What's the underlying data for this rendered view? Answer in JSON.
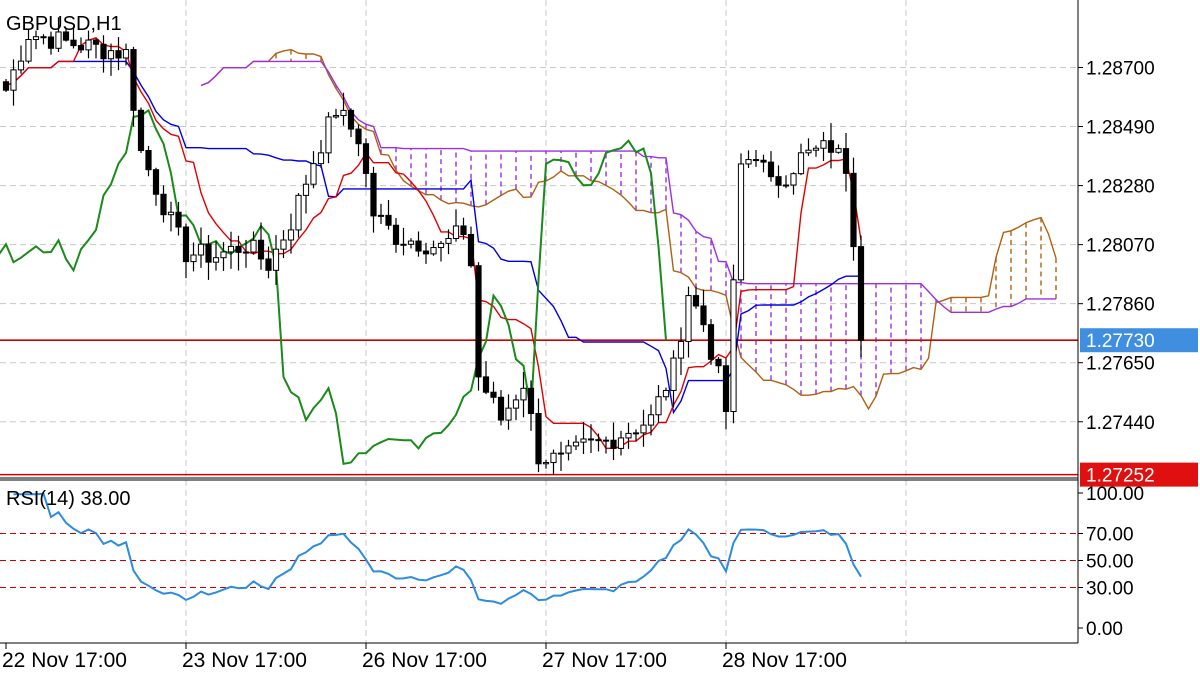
{
  "chart_data": [
    {
      "type": "candlestick",
      "symbol_label": "GBPUSD,H1",
      "y_ticks": [
        "1.28700",
        "1.28490",
        "1.28280",
        "1.28070",
        "1.27860",
        "1.27650",
        "1.27440"
      ],
      "ylim": [
        1.2724,
        1.2894
      ],
      "current_price_label": "1.27730",
      "current_price": 1.2773,
      "low_line_label": "1.27252",
      "low_line_price": 1.27252,
      "x_ticks": [
        "22 Nov 17:00",
        "23 Nov 17:00",
        "26 Nov 17:00",
        "27 Nov 17:00",
        "28 Nov 17:00"
      ],
      "x_tick_bars": [
        0,
        24,
        48,
        72,
        96
      ],
      "bar_count": 115,
      "cloud_forward_bars": 26,
      "anchors": [
        [
          0,
          1.2862
        ],
        [
          3,
          1.2882
        ],
        [
          8,
          1.2879
        ],
        [
          12,
          1.2877
        ],
        [
          16,
          1.2875
        ],
        [
          18,
          1.284
        ],
        [
          22,
          1.2815
        ],
        [
          24,
          1.2804
        ],
        [
          28,
          1.2803
        ],
        [
          32,
          1.2807
        ],
        [
          35,
          1.28
        ],
        [
          38,
          1.2815
        ],
        [
          41,
          1.2837
        ],
        [
          44,
          1.2855
        ],
        [
          47,
          1.2845
        ],
        [
          49,
          1.2818
        ],
        [
          52,
          1.281
        ],
        [
          55,
          1.2808
        ],
        [
          58,
          1.2806
        ],
        [
          61,
          1.2812
        ],
        [
          62,
          1.28
        ],
        [
          63,
          1.276
        ],
        [
          66,
          1.2745
        ],
        [
          69,
          1.2758
        ],
        [
          71,
          1.2732
        ],
        [
          74,
          1.273
        ],
        [
          77,
          1.2735
        ],
        [
          80,
          1.2737
        ],
        [
          83,
          1.2741
        ],
        [
          86,
          1.2745
        ],
        [
          89,
          1.2763
        ],
        [
          91,
          1.279
        ],
        [
          93,
          1.2779
        ],
        [
          95,
          1.276
        ],
        [
          96,
          1.2748
        ],
        [
          98,
          1.2835
        ],
        [
          100,
          1.284
        ],
        [
          102,
          1.2828
        ],
        [
          104,
          1.2832
        ],
        [
          106,
          1.2838
        ],
        [
          108,
          1.284
        ],
        [
          110,
          1.2842
        ],
        [
          112,
          1.2835
        ],
        [
          113,
          1.281
        ],
        [
          114,
          1.2773
        ]
      ],
      "tenkan_color": "#e00000",
      "kijun_color": "#0000e0",
      "chikou_color": "#1a8a1a",
      "span_a_color": "#b06010",
      "span_b_color": "#9a30e0",
      "bull_color": "#ffffff",
      "bear_color": "#000000",
      "hline_color": "#cc0000"
    },
    {
      "type": "line",
      "title": "RSI(14) 38.00",
      "period": 14,
      "last_value": 38.0,
      "y_ticks": [
        "100.00",
        "70.00",
        "50.00",
        "30.00",
        "0.00"
      ],
      "ylim": [
        0,
        100
      ],
      "levels": [
        70,
        50,
        30
      ],
      "line_color": "#2b8ce0",
      "level_color": "#cc0000"
    }
  ],
  "colors": {
    "axis": "#000000",
    "grid": "#c8c8c8",
    "price_tag": "#3f8ee0",
    "low_tag": "#e01010",
    "text": "#000000"
  }
}
